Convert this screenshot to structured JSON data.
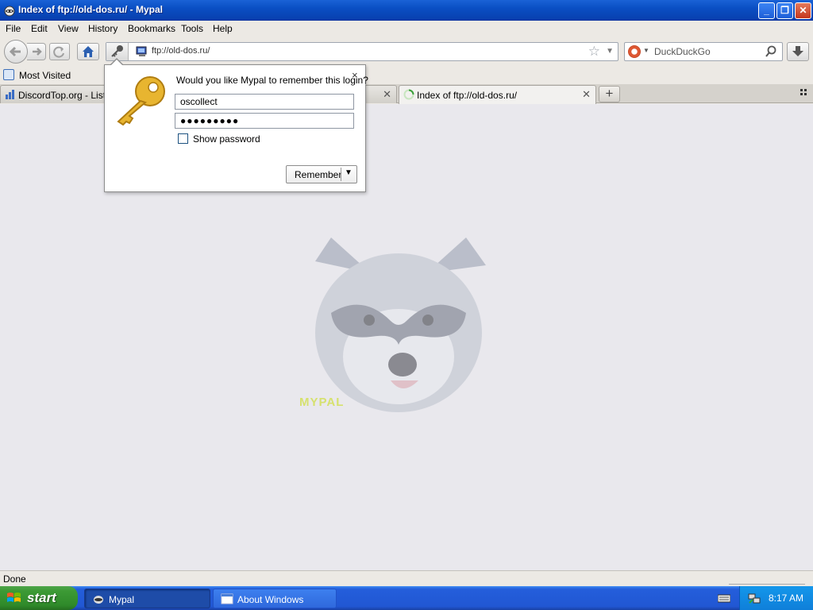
{
  "window": {
    "title": "Index of ftp://old-dos.ru/ - Mypal",
    "minimize": "_",
    "maximize": "❐",
    "close": "✕"
  },
  "menu": {
    "items": [
      "File",
      "Edit",
      "View",
      "History",
      "Bookmarks",
      "Tools",
      "Help"
    ]
  },
  "navbar": {
    "url": "ftp://old-dos.ru/",
    "search_placeholder": "DuckDuckGo"
  },
  "bookmarks": {
    "most_visited": "Most Visited"
  },
  "tabs": [
    {
      "label": "DiscordTop.org - List D",
      "active": false
    },
    {
      "label": "Index of ftp://old-dos.ru/",
      "active": true
    }
  ],
  "popup": {
    "question": "Would you like Mypal to remember this login?",
    "username": "oscollect",
    "password": "●●●●●●●●●",
    "show_password": "Show password",
    "remember": "Remember",
    "close": "×"
  },
  "content": {
    "caption": "MYPAL"
  },
  "status": {
    "text": "Done"
  },
  "taskbar": {
    "start": "start",
    "items": [
      "Mypal",
      "About Windows"
    ],
    "clock": "8:17 AM"
  },
  "colors": {
    "titlebar": "#0a4fc4",
    "taskbar": "#245edb",
    "start_button": "#3c9a35",
    "content_bg": "#e9e8ed"
  }
}
